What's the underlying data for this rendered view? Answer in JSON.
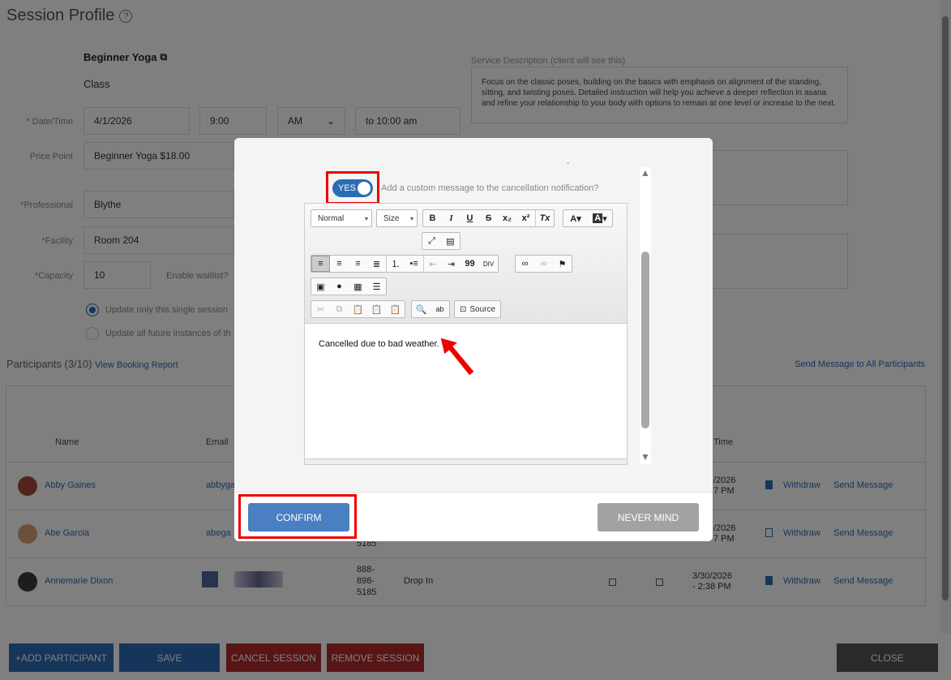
{
  "page": {
    "title": "Session Profile",
    "service_name": "Beginner Yoga",
    "service_type": "Class",
    "service_description_label": "Service Description (client will see this)",
    "service_description": "Focus on the classic poses, building on the basics with emphasis on alignment of the standing, sitting, and twisting poses. Detailed instruction will help you achieve a deeper reflection in asana and refine your relationship to your body with options to remain at one level or increase to the next.",
    "labels": {
      "datetime": "* Date/Time",
      "price_point": "Price Point",
      "professional": "*Professional",
      "facility": "*Facility",
      "capacity": "*Capacity",
      "waitlist": "Enable waitlist?"
    },
    "values": {
      "date": "4/1/2026",
      "time": "9:00",
      "ampm": "AM",
      "end_time": "to 10:00 am",
      "price_point": "Beginner Yoga $18.00",
      "professional": "Blythe",
      "facility": "Room 204",
      "capacity": "10"
    },
    "radio": {
      "single": "Update only this single session",
      "future": "Update all future instances of th"
    },
    "participants": {
      "title": "Participants (3/10)",
      "report_link": "View Booking Report",
      "send_all": "Send Message to All Participants",
      "headers": {
        "name": "Name",
        "email": "Email",
        "time": "Time"
      },
      "rows": [
        {
          "name": "Abby Gaines",
          "email": "abbyga",
          "date": "/2026",
          "time": "7 PM",
          "withdraw": "Withdraw",
          "message": "Send Message"
        },
        {
          "name": "Abe Garcia",
          "email": "abega",
          "phone_tail": "5185",
          "date": "/2026",
          "time": "7 PM",
          "withdraw": "Withdraw",
          "message": "Send Message"
        },
        {
          "name": "Annemarie Dixon",
          "phone1": "888-",
          "phone2": "898-",
          "phone3": "5185",
          "type": "Drop In",
          "date": "3/30/2026",
          "time": "- 2:38 PM",
          "withdraw": "Withdraw",
          "message": "Send Message"
        }
      ]
    },
    "footer": {
      "add": "+ADD PARTICIPANT",
      "save": "SAVE",
      "cancel": "CANCEL SESSION",
      "remove": "REMOVE SESSION",
      "close": "CLOSE"
    }
  },
  "modal": {
    "dash": "-",
    "toggle_label": "YES",
    "custom_message_prompt": "Add a custom message to the cancellation notification?",
    "editor": {
      "format_combo": "Normal",
      "size_combo": "Size",
      "source_label": "Source",
      "content": "Cancelled due to bad weather."
    },
    "confirm": "CONFIRM",
    "never_mind": "NEVER MIND"
  },
  "colors": {
    "primary": "#2a6db5",
    "confirm": "#4a7fc1",
    "highlight": "#ee0000",
    "danger": "#8b1f1f"
  }
}
